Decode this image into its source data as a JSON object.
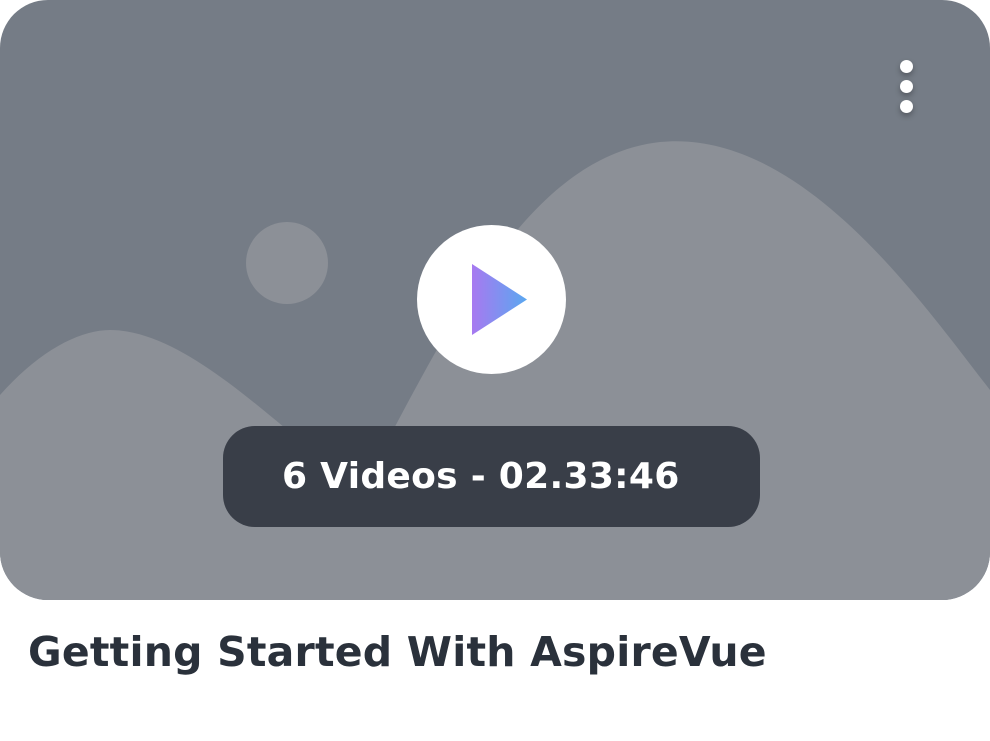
{
  "card": {
    "title": "Getting Started With AspireVue",
    "meta": "6 Videos - 02.33:46",
    "play_icon": "play-icon",
    "more_icon": "more-vertical-icon",
    "thumbnail_icon": "image-placeholder-icon"
  },
  "colors": {
    "thumbnail_bg": "#757c86",
    "thumbnail_shape": "#8c9097",
    "pill_bg": "#393e48",
    "title_text": "#2a313b",
    "play_gradient_start": "#a779f0",
    "play_gradient_end": "#5aa8f0"
  }
}
